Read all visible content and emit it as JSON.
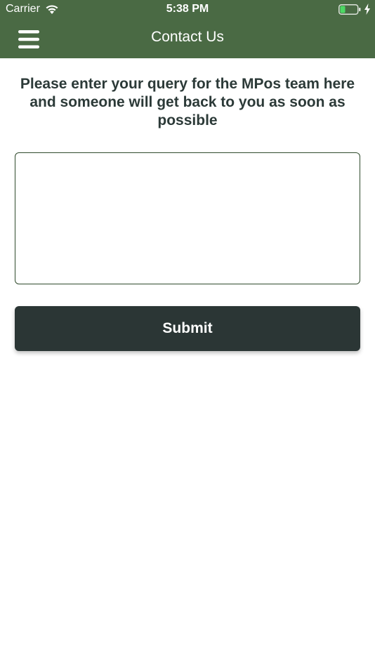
{
  "status_bar": {
    "carrier": "Carrier",
    "time": "5:38 PM",
    "wifi_icon": "wifi-icon",
    "battery_icon": "battery-icon",
    "charging_icon": "charging-bolt-icon"
  },
  "nav": {
    "title": "Contact Us",
    "menu_icon": "hamburger-menu-icon"
  },
  "form": {
    "instructions": "Please enter your query for the MPos team here and someone will get back to you as soon as possible",
    "query_value": "",
    "query_placeholder": "",
    "submit_label": "Submit"
  },
  "colors": {
    "header_green": "#4a6a44",
    "button_dark": "#2b3635",
    "text_dark": "#2c3a38",
    "battery_fill": "#4cd964"
  }
}
